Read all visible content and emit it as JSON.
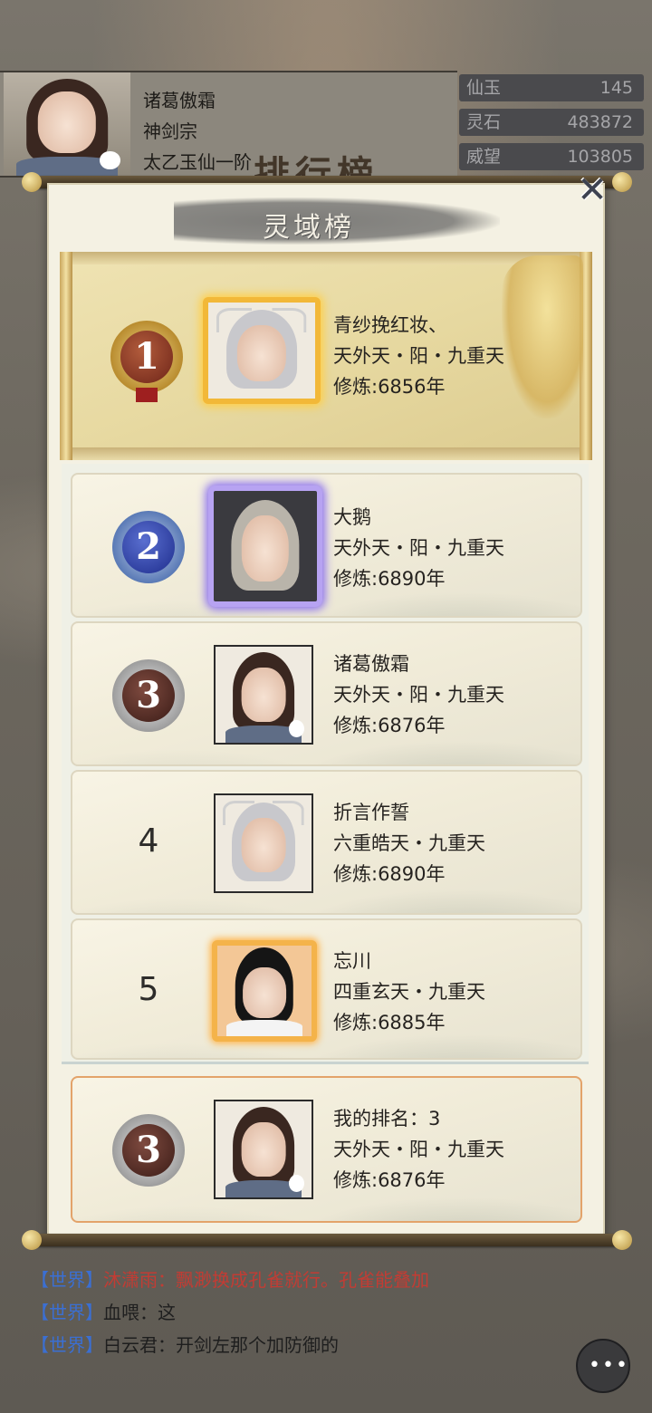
{
  "player": {
    "name": "诸葛傲霜",
    "sect": "神剑宗",
    "realm": "太乙玉仙一阶"
  },
  "resources": [
    {
      "label": "仙玉",
      "value": "145"
    },
    {
      "label": "灵石",
      "value": "483872"
    },
    {
      "label": "威望",
      "value": "103805"
    }
  ],
  "background": {
    "banner": "排行榜"
  },
  "modal": {
    "title": "灵域榜",
    "close_icon": "close-icon",
    "rankings": [
      {
        "rank": "1",
        "name": "青纱挽红妆、",
        "realm": "天外天・阳・九重天",
        "cultivation": "修炼:6856年",
        "medal": "gold-medal"
      },
      {
        "rank": "2",
        "name": "大鹅",
        "realm": "天外天・阳・九重天",
        "cultivation": "修炼:6890年",
        "medal": "blue-medal"
      },
      {
        "rank": "3",
        "name": "诸葛傲霜",
        "realm": "天外天・阳・九重天",
        "cultivation": "修炼:6876年",
        "medal": "silver-medal"
      },
      {
        "rank": "4",
        "name": "折言作誓",
        "realm": "六重皓天・九重天",
        "cultivation": "修炼:6890年"
      },
      {
        "rank": "5",
        "name": "忘川",
        "realm": "四重玄天・九重天",
        "cultivation": "修炼:6885年"
      }
    ],
    "my_rank": {
      "rank": "3",
      "label": "我的排名：3",
      "realm": "天外天・阳・九重天",
      "cultivation": "修炼:6876年"
    }
  },
  "chat": [
    {
      "tag": "【世界】",
      "text": "沐潇雨：飘渺换成孔雀就行。孔雀能叠加",
      "color": "#c23c34"
    },
    {
      "tag": "【世界】",
      "text": "血喂：这",
      "color": "#1e1e1e"
    },
    {
      "tag": "【世界】",
      "text": "白云君：开剑左那个加防御的",
      "color": "#1e1e1e"
    }
  ],
  "chat_button_icon": "chat-bubble-icon",
  "colors": {
    "chat_tag": "#3b6fd2",
    "highlight_border": "#e3a36a",
    "first_bg": "#e7d9a1"
  }
}
